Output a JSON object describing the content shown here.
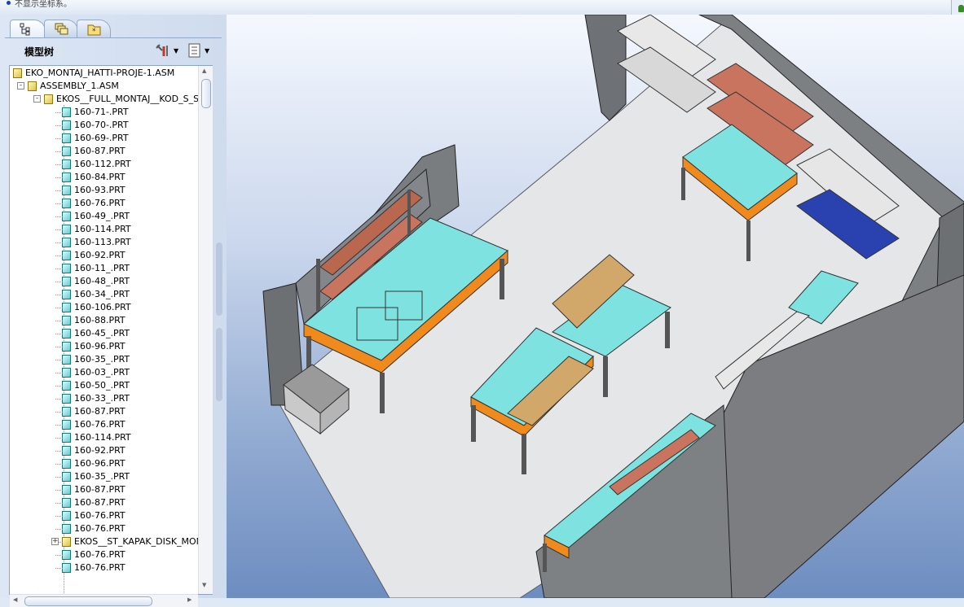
{
  "status_bar": {
    "message": "不显示坐标系。"
  },
  "panel": {
    "tabs": [
      {
        "name": "model-tree-tab",
        "icon": "tree-icon",
        "active": true
      },
      {
        "name": "layers-tab",
        "icon": "layers-icon",
        "active": false
      },
      {
        "name": "favorites-tab",
        "icon": "folder-star-icon",
        "active": false
      }
    ],
    "title": "模型树",
    "toolbar": [
      {
        "icon": "tools-icon",
        "dropdown": true
      },
      {
        "icon": "tree-settings-icon",
        "dropdown": true
      }
    ]
  },
  "tree": {
    "items": [
      {
        "label": "EKO_MONTAJ_HATTI-PROJE-1.ASM",
        "type": "asm"
      },
      {
        "label": "ASSEMBLY_1.ASM",
        "type": "asm",
        "toggle": "-"
      },
      {
        "label": "EKOS__FULL_MONTAJ__KOD_S_ST",
        "type": "asm",
        "toggle": "-"
      },
      {
        "label": "160-71-.PRT",
        "type": "prt"
      },
      {
        "label": "160-70-.PRT",
        "type": "prt"
      },
      {
        "label": "160-69-.PRT",
        "type": "prt"
      },
      {
        "label": "160-87.PRT",
        "type": "prt"
      },
      {
        "label": "160-112.PRT",
        "type": "prt"
      },
      {
        "label": "160-84.PRT",
        "type": "prt"
      },
      {
        "label": "160-93.PRT",
        "type": "prt"
      },
      {
        "label": "160-76.PRT",
        "type": "prt"
      },
      {
        "label": "160-49_.PRT",
        "type": "prt"
      },
      {
        "label": "160-114.PRT",
        "type": "prt"
      },
      {
        "label": "160-113.PRT",
        "type": "prt"
      },
      {
        "label": "160-92.PRT",
        "type": "prt"
      },
      {
        "label": "160-11_.PRT",
        "type": "prt"
      },
      {
        "label": "160-48_.PRT",
        "type": "prt"
      },
      {
        "label": "160-34_.PRT",
        "type": "prt"
      },
      {
        "label": "160-106.PRT",
        "type": "prt"
      },
      {
        "label": "160-88.PRT",
        "type": "prt"
      },
      {
        "label": "160-45_.PRT",
        "type": "prt"
      },
      {
        "label": "160-96.PRT",
        "type": "prt"
      },
      {
        "label": "160-35_.PRT",
        "type": "prt"
      },
      {
        "label": "160-03_.PRT",
        "type": "prt"
      },
      {
        "label": "160-50_.PRT",
        "type": "prt"
      },
      {
        "label": "160-33_.PRT",
        "type": "prt"
      },
      {
        "label": "160-87.PRT",
        "type": "prt"
      },
      {
        "label": "160-76.PRT",
        "type": "prt"
      },
      {
        "label": "160-114.PRT",
        "type": "prt"
      },
      {
        "label": "160-92.PRT",
        "type": "prt"
      },
      {
        "label": "160-96.PRT",
        "type": "prt"
      },
      {
        "label": "160-35_.PRT",
        "type": "prt"
      },
      {
        "label": "160-87.PRT",
        "type": "prt"
      },
      {
        "label": "160-87.PRT",
        "type": "prt"
      },
      {
        "label": "160-76.PRT",
        "type": "prt"
      },
      {
        "label": "160-76.PRT",
        "type": "prt"
      },
      {
        "label": "EKOS__ST_KAPAK_DISK_MONT",
        "type": "asm",
        "toggle": "+"
      },
      {
        "label": "160-76.PRT",
        "type": "prt"
      },
      {
        "label": "160-76.PRT",
        "type": "prt"
      }
    ]
  },
  "colors": {
    "wall": "#7b7d80",
    "floor": "#e6e8ea",
    "bench_top": "#7ee3e0",
    "shelf": "#c8745e",
    "accent": "#f08a1c",
    "bin": "#2a42b0"
  }
}
